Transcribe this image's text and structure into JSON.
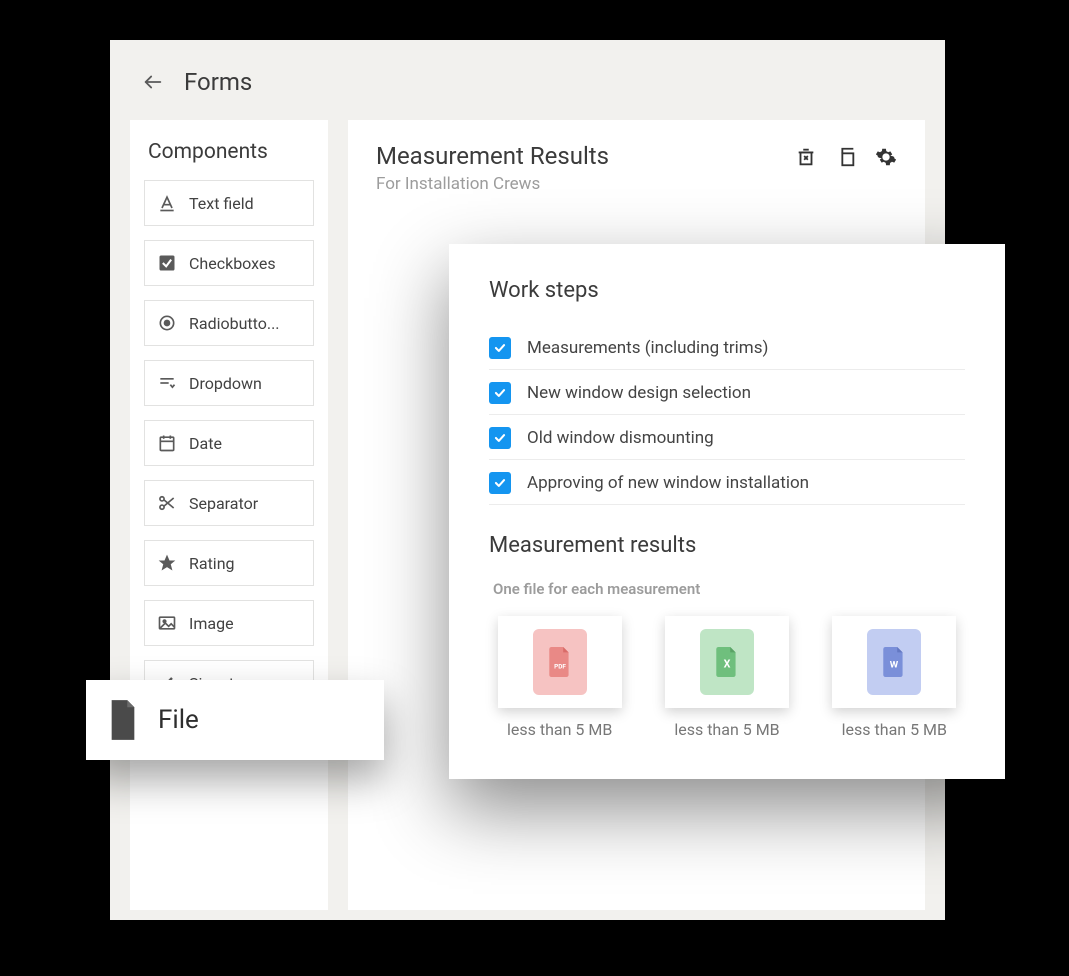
{
  "header": {
    "title": "Forms"
  },
  "sidebar": {
    "title": "Components",
    "items": [
      {
        "label": "Text field"
      },
      {
        "label": "Checkboxes"
      },
      {
        "label": "Radiobutto..."
      },
      {
        "label": "Dropdown"
      },
      {
        "label": "Date"
      },
      {
        "label": "Separator"
      },
      {
        "label": "Rating"
      },
      {
        "label": "Image"
      },
      {
        "label": "Signature"
      }
    ]
  },
  "drag": {
    "label": "File"
  },
  "main": {
    "title": "Measurement Results",
    "subtitle": "For Installation Crews"
  },
  "form": {
    "work_steps_title": "Work steps",
    "steps": [
      {
        "label": "Measurements (including trims)",
        "checked": true
      },
      {
        "label": "New window design selection",
        "checked": true
      },
      {
        "label": "Old window dismounting",
        "checked": true
      },
      {
        "label": "Approving of new window installation",
        "checked": true
      }
    ],
    "results_title": "Measurement results",
    "file_hint": "One file for each measurement",
    "files": [
      {
        "type": "pdf",
        "caption": "less than 5 MB"
      },
      {
        "type": "xls",
        "caption": "less than 5 MB"
      },
      {
        "type": "doc",
        "caption": "less than 5 MB"
      }
    ]
  }
}
